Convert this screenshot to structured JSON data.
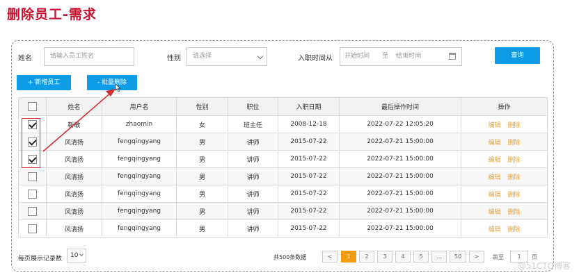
{
  "page_title": "删除员工-需求",
  "search": {
    "name_label": "姓名",
    "name_placeholder": "请输入员工姓名",
    "gender_label": "性别",
    "gender_placeholder": "请选择",
    "date_label": "入职时间",
    "date_from_label": "从",
    "date_start_placeholder": "开始时间",
    "date_to_label": "至",
    "date_end_placeholder": "结束时间",
    "query_button": "查询"
  },
  "actions": {
    "add_button": "+ 新增员工",
    "batch_delete_button": "- 批量删除"
  },
  "table": {
    "headers": [
      "姓名",
      "用户名",
      "性别",
      "职位",
      "入职日期",
      "最后操作时间",
      "操作"
    ],
    "edit_label": "编辑",
    "delete_label": "删除",
    "rows": [
      {
        "checked": true,
        "name": "靳敏",
        "username": "zhaomin",
        "gender": "女",
        "position": "班主任",
        "hire_date": "2008-12-18",
        "last_op": "2022-07-22 12:05:20"
      },
      {
        "checked": true,
        "name": "风清扬",
        "username": "fengqingyang",
        "gender": "男",
        "position": "讲师",
        "hire_date": "2015-07-22",
        "last_op": "2022-07-21 15:00:00"
      },
      {
        "checked": true,
        "name": "风清扬",
        "username": "fengqingyang",
        "gender": "男",
        "position": "讲师",
        "hire_date": "2015-07-22",
        "last_op": "2022-07-21 15:00:00"
      },
      {
        "checked": false,
        "name": "风清扬",
        "username": "fengqingyang",
        "gender": "男",
        "position": "讲师",
        "hire_date": "2015-07-22",
        "last_op": "2022-07-21 15:00:00"
      },
      {
        "checked": false,
        "name": "风清扬",
        "username": "fengqingyang",
        "gender": "男",
        "position": "讲师",
        "hire_date": "2015-07-22",
        "last_op": "2022-07-21 15:00:00"
      },
      {
        "checked": false,
        "name": "风清扬",
        "username": "fengqingyang",
        "gender": "男",
        "position": "讲师",
        "hire_date": "2015-07-22",
        "last_op": "2022-07-21 15:00:00"
      },
      {
        "checked": false,
        "name": "风清扬",
        "username": "fengqingyang",
        "gender": "男",
        "position": "讲师",
        "hire_date": "2015-07-22",
        "last_op": "2022-07-21 15:00:00"
      }
    ]
  },
  "footer": {
    "page_size_label": "每页展示记录数",
    "page_size_value": "10",
    "total_text": "共500条数据",
    "prev": "<",
    "pages": [
      "1",
      "2",
      "3",
      "4",
      "5",
      "...",
      "50"
    ],
    "next": ">",
    "current_page": "1",
    "jump_label": "跳至",
    "jump_value": "1",
    "page_suffix": "页"
  },
  "watermark": "@51CTO博客",
  "colors": {
    "title": "#c8102e",
    "primary": "#0f9ce6",
    "operation": "#e8a33a",
    "active_page": "#f39c12",
    "annotation": "#d32f2f"
  }
}
